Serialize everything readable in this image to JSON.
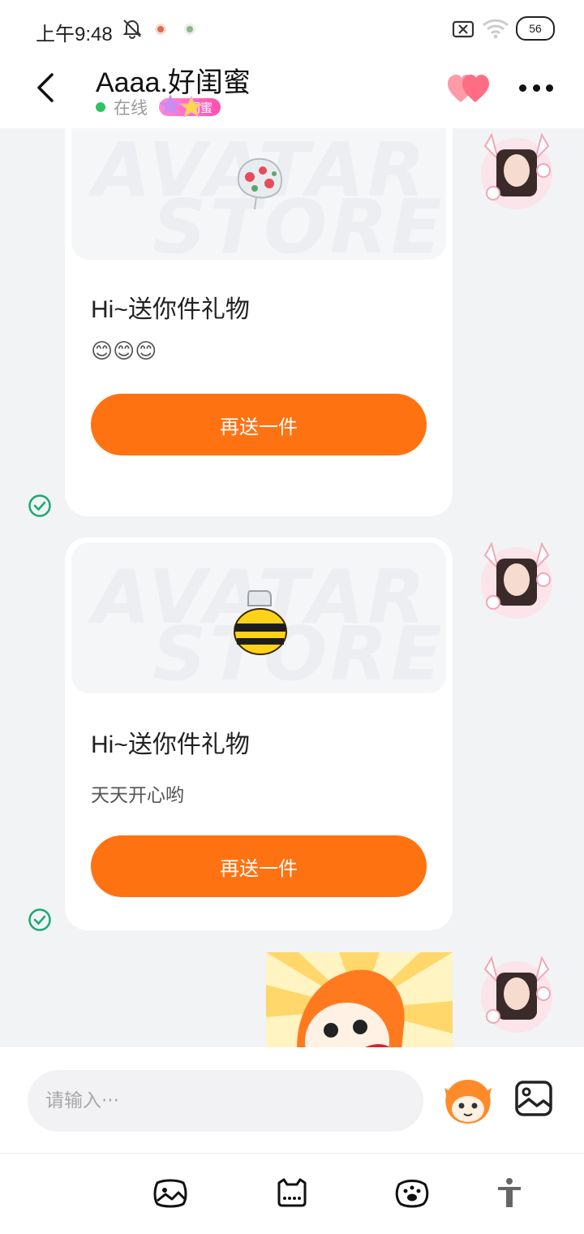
{
  "status_bar": {
    "time": "上午9:48",
    "battery": "56",
    "icons": [
      "bell-off-icon",
      "app-notification-icon",
      "app-notification-icon",
      "sim-off-icon",
      "wifi-icon",
      "battery-icon"
    ]
  },
  "header": {
    "title": "Aaaa.好闺蜜",
    "online_status": "在线",
    "relationship_badge": "闺蜜",
    "online_color": "#2ec463",
    "badge_color": "#ff4fb0"
  },
  "messages": [
    {
      "type": "gift",
      "gift_icon": "mouse-gift-icon",
      "watermark_line1": "AVATAR",
      "watermark_line2": "STORE",
      "title": "Hi~送你件礼物",
      "message": "😊😊😊",
      "button": "再送一件",
      "status": "sent-check-icon"
    },
    {
      "type": "gift",
      "gift_icon": "bee-jar-gift-icon",
      "watermark_line1": "AVATAR",
      "watermark_line2": "STORE",
      "title": "Hi~送你件礼物",
      "message": "天天开心哟",
      "button": "再送一件",
      "status": "sent-check-icon"
    },
    {
      "type": "sticker",
      "sticker_icon": "cartoon-mascot-sticker"
    }
  ],
  "input": {
    "placeholder": "请输入···"
  },
  "toolbar": {
    "items": [
      "album-icon",
      "keyboard-chat-icon",
      "paw-icon",
      "accessibility-icon"
    ]
  },
  "colors": {
    "accent": "#ff7212",
    "check": "#19a974"
  }
}
